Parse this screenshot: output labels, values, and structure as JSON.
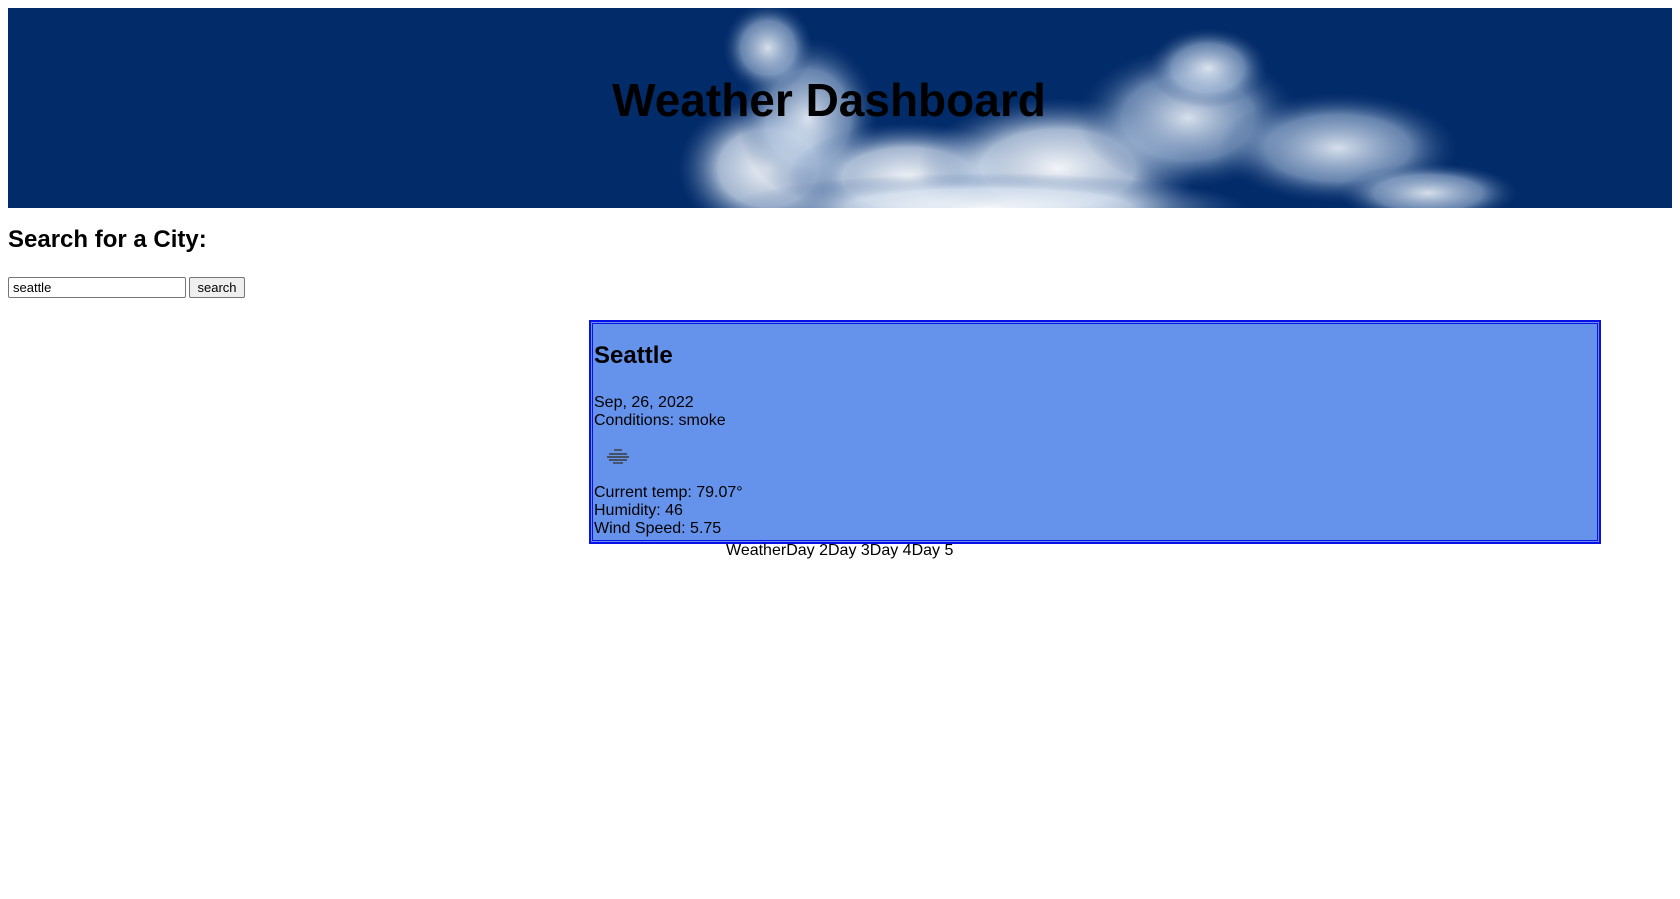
{
  "header": {
    "title": "Weather Dashboard"
  },
  "search": {
    "heading": "Search for a City:",
    "input_value": "seattle",
    "button_label": "search"
  },
  "current": {
    "city": "Seattle",
    "date": "Sep, 26, 2022",
    "conditions": "Conditions: smoke",
    "icon": "smoke-haze-icon",
    "temp": "Current temp: 79.07°",
    "humidity": "Humidity: 46",
    "wind": "Wind Speed: 5.75"
  },
  "forecast": {
    "labels": [
      "Weather",
      "Day 2",
      "Day 3",
      "Day 4",
      "Day 5"
    ]
  },
  "colors": {
    "banner_bg": "#022b69",
    "card_bg": "#6593eb",
    "card_border": "#0a10e6"
  }
}
